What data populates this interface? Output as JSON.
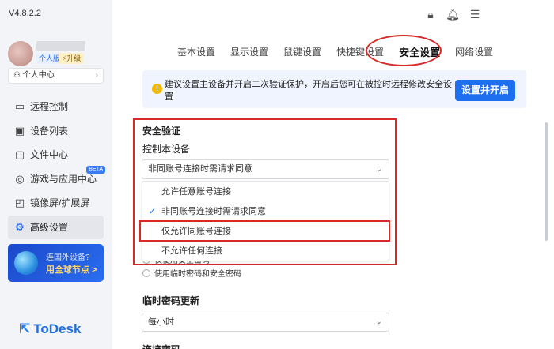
{
  "app": {
    "version": "V4.8.2.2",
    "badges": {
      "personal": "个人版",
      "upgrade": "⚡升级"
    },
    "personal_center": "个人中心",
    "logo_text": "ToDesk"
  },
  "sidebar": {
    "items": [
      {
        "label": "远程控制",
        "icon": "monitor-icon",
        "active": false
      },
      {
        "label": "设备列表",
        "icon": "device-list-icon",
        "active": false
      },
      {
        "label": "文件中心",
        "icon": "folder-icon",
        "active": false
      },
      {
        "label": "游戏与应用中心",
        "icon": "gamepad-icon",
        "active": false,
        "badge": "BETA"
      },
      {
        "label": "镜像屏/扩展屏",
        "icon": "cast-icon",
        "active": false
      },
      {
        "label": "高级设置",
        "icon": "gear-icon",
        "active": true
      }
    ],
    "promo": {
      "line1": "连国外设备?",
      "line2": "用全球节点 >"
    }
  },
  "tabs": [
    {
      "label": "基本设置",
      "active": false
    },
    {
      "label": "显示设置",
      "active": false
    },
    {
      "label": "鼠键设置",
      "active": false
    },
    {
      "label": "快捷键设置",
      "active": false
    },
    {
      "label": "安全设置",
      "active": true
    },
    {
      "label": "网络设置",
      "active": false
    }
  ],
  "notice": {
    "text": "建议设置主设备并开启二次验证保护，开启后您可在被控时远程修改安全设置",
    "button": "设置并开启"
  },
  "security": {
    "title": "安全验证",
    "subtitle": "控制本设备",
    "selected": "非同账号连接时需请求同意",
    "options": [
      {
        "label": "允许任意账号连接",
        "checked": false
      },
      {
        "label": "非同账号连接时需请求同意",
        "checked": true
      },
      {
        "label": "仅允许同账号连接",
        "checked": false
      },
      {
        "label": "不允许任何连接",
        "checked": false
      }
    ],
    "radios": [
      {
        "label": "仅使用安全密码",
        "partial": true
      },
      {
        "label": "使用临时密码和安全密码"
      }
    ]
  },
  "temp_password": {
    "title": "临时密码更新",
    "selected": "每小时"
  },
  "next_section": {
    "title": "连接密码"
  },
  "colors": {
    "accent": "#1e6ff0",
    "highlight": "#d82828",
    "warning": "#f5b800"
  }
}
